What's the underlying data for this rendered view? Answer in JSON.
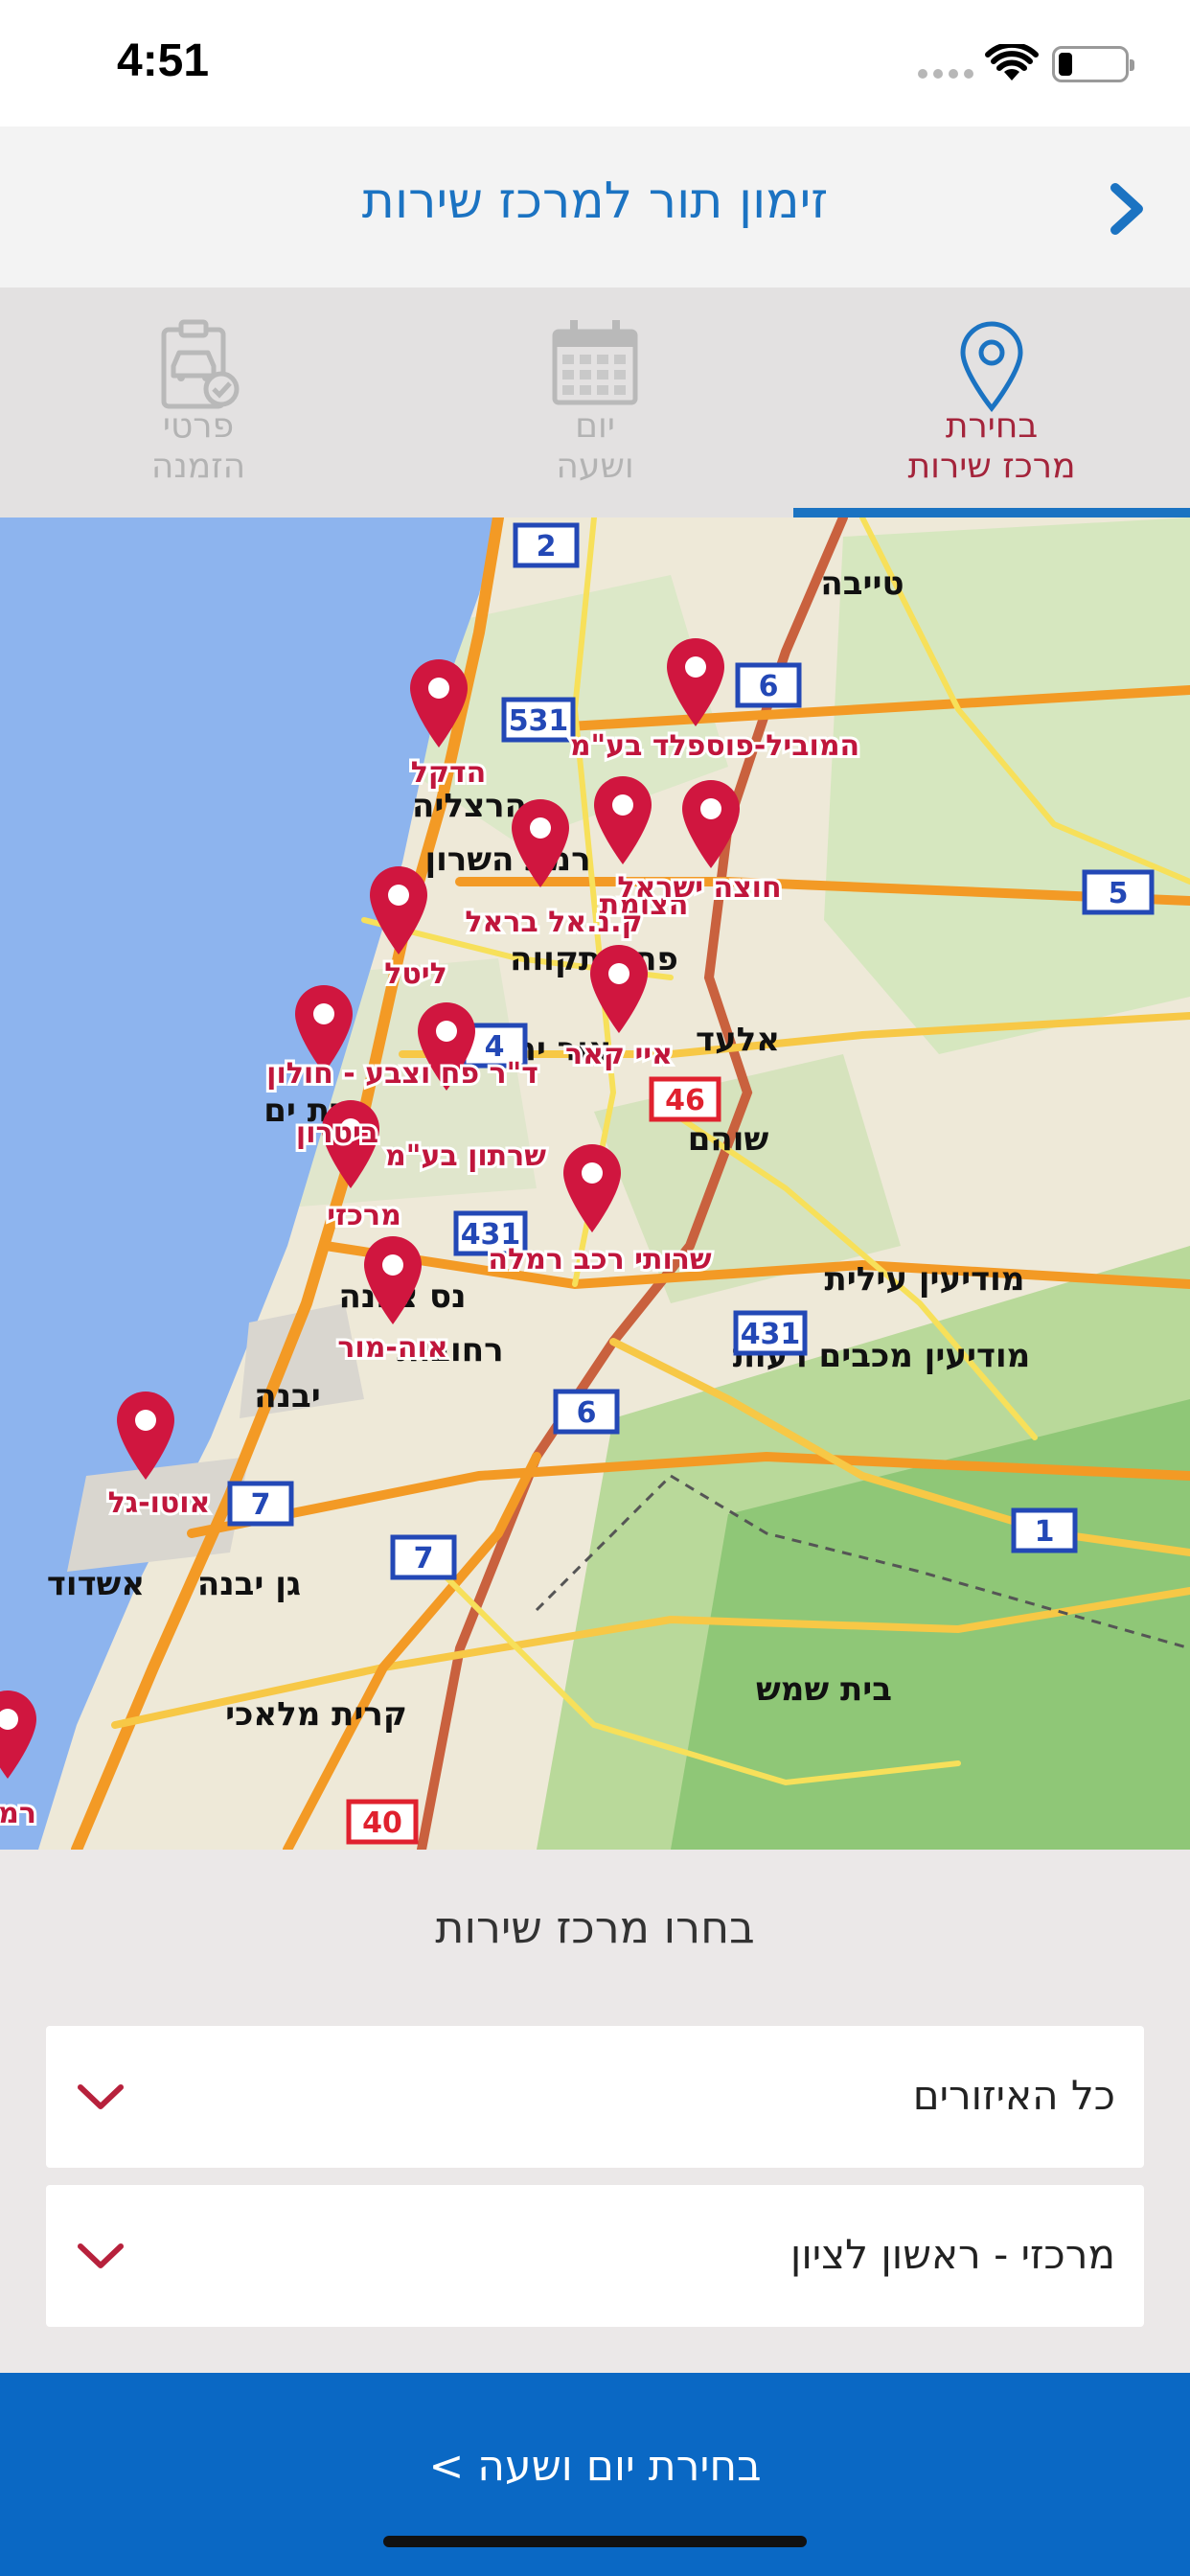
{
  "status_bar": {
    "time": "4:51"
  },
  "header": {
    "title": "זימון תור למרכז שירות"
  },
  "tabs": [
    {
      "label_line1": "בחירת",
      "label_line2": "מרכז שירות",
      "icon": "location-pin-icon",
      "active": true
    },
    {
      "label_line1": "יום",
      "label_line2": "ושעה",
      "icon": "calendar-icon",
      "active": false
    },
    {
      "label_line1": "פרטי",
      "label_line2": "הזמנה",
      "icon": "clipboard-car-icon",
      "active": false
    }
  ],
  "map": {
    "cities": [
      {
        "name": "טייבה"
      },
      {
        "name": "הרצליה"
      },
      {
        "name": "רמת השרון"
      },
      {
        "name": "פתח תקווה"
      },
      {
        "name": "אלעד"
      },
      {
        "name": "אור יהודה"
      },
      {
        "name": "שוהם"
      },
      {
        "name": "בת ים"
      },
      {
        "name": "נס ציונה"
      },
      {
        "name": "רחובות"
      },
      {
        "name": "יבנה"
      },
      {
        "name": "אשדוד"
      },
      {
        "name": "גן יבנה"
      },
      {
        "name": "מודיעין עילית"
      },
      {
        "name": "מודיעין מכבים רעות"
      },
      {
        "name": "בית שמש"
      },
      {
        "name": "קרית מלאכי"
      }
    ],
    "road_shields": [
      "2",
      "531",
      "6",
      "5",
      "4",
      "46",
      "431",
      "431",
      "6",
      "7",
      "7",
      "1",
      "40"
    ],
    "centers": [
      {
        "name": "הדקל"
      },
      {
        "name": "המוביל-פוספלד בע\"מ"
      },
      {
        "name": "הצומת"
      },
      {
        "name": "חוצה ישראל"
      },
      {
        "name": "ק.נ.אל בראל"
      },
      {
        "name": "ליטל"
      },
      {
        "name": "איי קאר"
      },
      {
        "name": "ד\"ר פח וצבע - חולון"
      },
      {
        "name": "ביטרון"
      },
      {
        "name": "שרתון בע\"מ"
      },
      {
        "name": "מרכזי"
      },
      {
        "name": "שרותי רכב רמלה"
      },
      {
        "name": "אוה-מור"
      },
      {
        "name": "אוטו-גל"
      },
      {
        "name": "רמ"
      }
    ]
  },
  "picker": {
    "title": "בחרו מרכז שירות",
    "region_value": "כל האיזורים",
    "center_value": "מרכזי  - ראשון לציון"
  },
  "bottom_button": {
    "label": "בחירת יום ושעה >"
  },
  "colors": {
    "accent": "#1b73c2",
    "active_tab": "#a4243b",
    "pin": "#d0163f",
    "button": "#0a68c4"
  }
}
